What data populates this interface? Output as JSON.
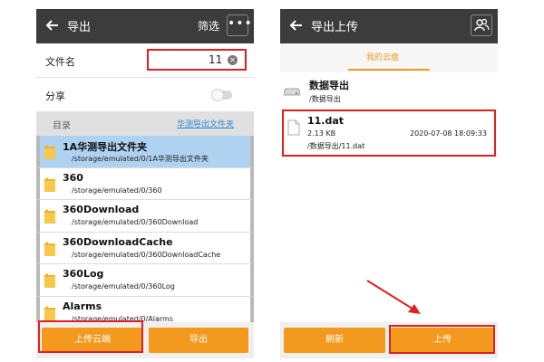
{
  "colors": {
    "accent_orange": "#f39a1e",
    "highlight_red": "#e02020",
    "selected_blue": "#aed2f0",
    "link_blue": "#2c8ad1",
    "appbar": "#3c3c3c"
  },
  "left_screen": {
    "title": "导出",
    "filter_label": "筛选",
    "more_icon": "more-dots-icon",
    "file_name": {
      "label": "文件名",
      "value": "11"
    },
    "share": {
      "label": "分享",
      "checked": false
    },
    "directory": {
      "label": "目录",
      "link": "华测导出文件夹"
    },
    "folders": [
      {
        "name": "1A华测导出文件夹",
        "path": "/storage/emulated/0/1A华测导出文件夹",
        "selected": true
      },
      {
        "name": "360",
        "path": "/storage/emulated/0/360",
        "selected": false
      },
      {
        "name": "360Download",
        "path": "/storage/emulated/0/360Download",
        "selected": false
      },
      {
        "name": "360DownloadCache",
        "path": "/storage/emulated/0/360DownloadCache",
        "selected": false
      },
      {
        "name": "360Log",
        "path": "/storage/emulated/0/360Log",
        "selected": false
      },
      {
        "name": "Alarms",
        "path": "/storage/emulated/0/Alarms",
        "selected": false
      }
    ],
    "buttons": {
      "upload_cloud": "上传云端",
      "export": "导出"
    }
  },
  "right_screen": {
    "title": "导出上传",
    "tab": "我的云盘",
    "cloud_folder": {
      "name": "数据导出",
      "path": "/数据导出"
    },
    "file": {
      "name": "11.dat",
      "size": "2.13 KB",
      "date": "2020-07-08 18:09:33",
      "path": "/数据导出/11.dat"
    },
    "buttons": {
      "refresh": "刷新",
      "upload": "上传"
    }
  }
}
